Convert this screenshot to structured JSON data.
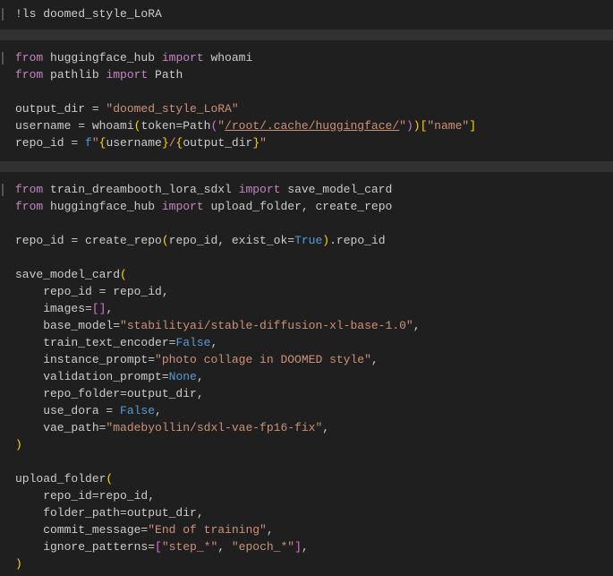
{
  "cells": [
    {
      "lines": [
        [
          [
            "!ls doomed_style_LoRA",
            "t"
          ]
        ]
      ]
    },
    {
      "lines": [
        [
          [
            "from",
            "kw"
          ],
          [
            " huggingface_hub ",
            "t"
          ],
          [
            "import",
            "kw"
          ],
          [
            " whoami",
            "t"
          ]
        ],
        [
          [
            "from",
            "kw"
          ],
          [
            " pathlib ",
            "t"
          ],
          [
            "import",
            "kw"
          ],
          [
            " Path",
            "t"
          ]
        ],
        [],
        [
          [
            "output_dir = ",
            "t"
          ],
          [
            "\"doomed_style_LoRA\"",
            "str"
          ]
        ],
        [
          [
            "username = whoami",
            "t"
          ],
          [
            "(",
            "b1"
          ],
          [
            "token=Path",
            "t"
          ],
          [
            "(",
            "b2"
          ],
          [
            "\"",
            "str"
          ],
          [
            "/root/.cache/huggingface/",
            "link"
          ],
          [
            "\"",
            "str"
          ],
          [
            ")",
            "b2"
          ],
          [
            ")",
            "b1"
          ],
          [
            "[",
            "b1"
          ],
          [
            "\"name\"",
            "str"
          ],
          [
            "]",
            "b1"
          ]
        ],
        [
          [
            "repo_id = ",
            "t"
          ],
          [
            "f",
            "con"
          ],
          [
            "\"",
            "str"
          ],
          [
            "{",
            "b1"
          ],
          [
            "username",
            "t"
          ],
          [
            "}",
            "b1"
          ],
          [
            "/",
            "str"
          ],
          [
            "{",
            "b1"
          ],
          [
            "output_dir",
            "t"
          ],
          [
            "}",
            "b1"
          ],
          [
            "\"",
            "str"
          ]
        ]
      ]
    },
    {
      "lines": [
        [
          [
            "from",
            "kw"
          ],
          [
            " train_dreambooth_lora_sdxl ",
            "t"
          ],
          [
            "import",
            "kw"
          ],
          [
            " save_model_card",
            "t"
          ]
        ],
        [
          [
            "from",
            "kw"
          ],
          [
            " huggingface_hub ",
            "t"
          ],
          [
            "import",
            "kw"
          ],
          [
            " upload_folder, create_repo",
            "t"
          ]
        ],
        [],
        [
          [
            "repo_id = create_repo",
            "t"
          ],
          [
            "(",
            "b1"
          ],
          [
            "repo_id, exist_ok=",
            "t"
          ],
          [
            "True",
            "con"
          ],
          [
            ")",
            "b1"
          ],
          [
            ".repo_id",
            "t"
          ]
        ],
        [],
        [
          [
            "save_model_card",
            "t"
          ],
          [
            "(",
            "b1"
          ]
        ],
        [
          [
            "    repo_id = repo_id,",
            "t"
          ]
        ],
        [
          [
            "    images=",
            "t"
          ],
          [
            "[]",
            "b2"
          ],
          [
            ",",
            "t"
          ]
        ],
        [
          [
            "    base_model=",
            "t"
          ],
          [
            "\"stabilityai/stable-diffusion-xl-base-1.0\"",
            "str"
          ],
          [
            ",",
            "t"
          ]
        ],
        [
          [
            "    train_text_encoder=",
            "t"
          ],
          [
            "False",
            "con"
          ],
          [
            ",",
            "t"
          ]
        ],
        [
          [
            "    instance_prompt=",
            "t"
          ],
          [
            "\"photo collage in DOOMED style\"",
            "str"
          ],
          [
            ",",
            "t"
          ]
        ],
        [
          [
            "    validation_prompt=",
            "t"
          ],
          [
            "None",
            "con"
          ],
          [
            ",",
            "t"
          ]
        ],
        [
          [
            "    repo_folder=output_dir,",
            "t"
          ]
        ],
        [
          [
            "    use_dora = ",
            "t"
          ],
          [
            "False",
            "con"
          ],
          [
            ",",
            "t"
          ]
        ],
        [
          [
            "    vae_path=",
            "t"
          ],
          [
            "\"madebyollin/sdxl-vae-fp16-fix\"",
            "str"
          ],
          [
            ",",
            "t"
          ]
        ],
        [
          [
            ")",
            "b1"
          ]
        ],
        [],
        [
          [
            "upload_folder",
            "t"
          ],
          [
            "(",
            "b1"
          ]
        ],
        [
          [
            "    repo_id=repo_id,",
            "t"
          ]
        ],
        [
          [
            "    folder_path=output_dir,",
            "t"
          ]
        ],
        [
          [
            "    commit_message=",
            "t"
          ],
          [
            "\"End of training\"",
            "str"
          ],
          [
            ",",
            "t"
          ]
        ],
        [
          [
            "    ignore_patterns=",
            "t"
          ],
          [
            "[",
            "b2"
          ],
          [
            "\"step_*\"",
            "str"
          ],
          [
            ", ",
            "t"
          ],
          [
            "\"epoch_*\"",
            "str"
          ],
          [
            "]",
            "b2"
          ],
          [
            ",",
            "t"
          ]
        ],
        [
          [
            ")",
            "b1"
          ]
        ]
      ]
    }
  ]
}
